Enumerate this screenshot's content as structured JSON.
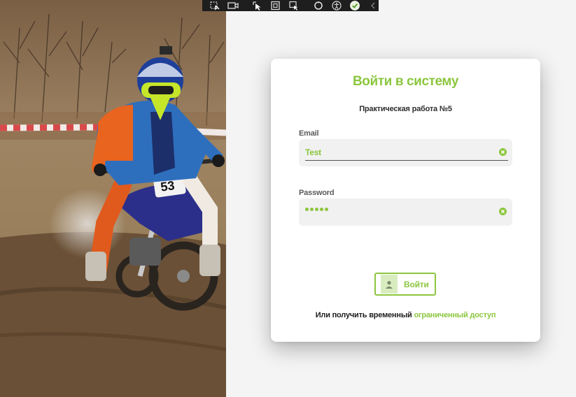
{
  "photo": {
    "alt": "Motocross rider",
    "bike_number": "53"
  },
  "devtools": {
    "icons": [
      "select-element-icon",
      "video-icon",
      "inspect-cursor-icon",
      "frame-icon",
      "hot-reload-icon",
      "refresh-icon",
      "accessibility-icon",
      "check-icon",
      "collapse-chevron-icon"
    ]
  },
  "login": {
    "title": "Войти в систему",
    "subtitle": "Практическая работа №5",
    "email": {
      "label": "Email",
      "value": "Test"
    },
    "password": {
      "label": "Password",
      "masked_length": 5
    },
    "login_button": "Войти",
    "alt_prefix": "Или получить временный",
    "alt_link": "ограниченный доступ"
  },
  "colors": {
    "accent": "#8cc63f",
    "card_bg": "#ffffff",
    "page_bg": "#f4f4f4",
    "field_bg": "#f1f1f1",
    "devbar_bg": "#1e1e1e"
  }
}
